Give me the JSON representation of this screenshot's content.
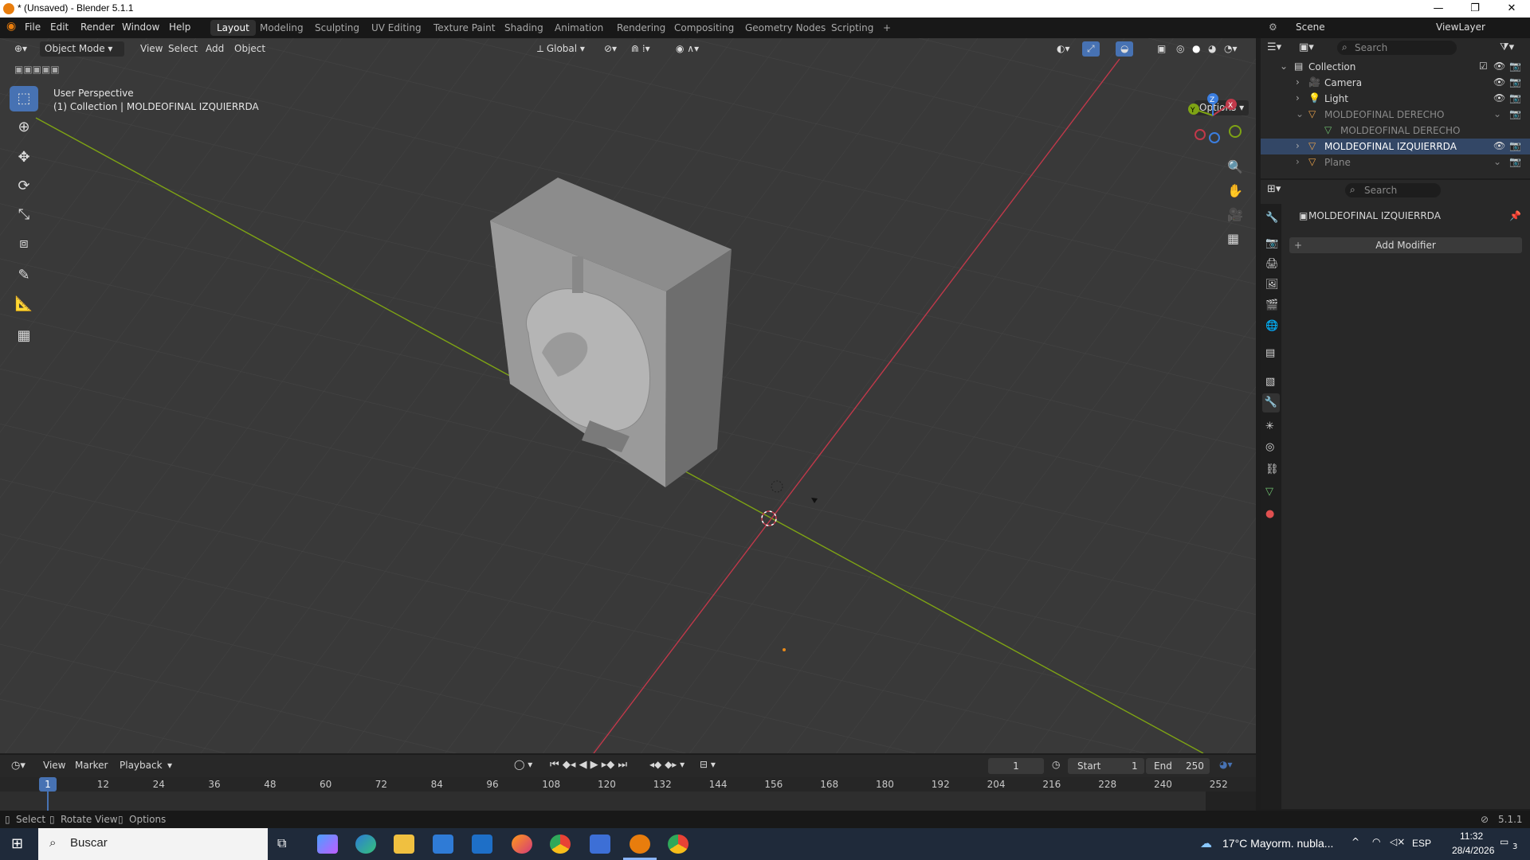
{
  "window": {
    "title": "* (Unsaved) - Blender 5.1.1",
    "min": "—",
    "max": "❐",
    "close": "✕"
  },
  "menu": [
    "File",
    "Edit",
    "Render",
    "Window",
    "Help"
  ],
  "workspaces": [
    "Layout",
    "Modeling",
    "Sculpting",
    "UV Editing",
    "Texture Paint",
    "Shading",
    "Animation",
    "Rendering",
    "Compositing",
    "Geometry Nodes",
    "Scripting"
  ],
  "workspace_add": "+",
  "scene": {
    "name": "Scene",
    "view_layer": "ViewLayer"
  },
  "viewport_header": {
    "mode": "Object Mode",
    "menus": [
      "View",
      "Select",
      "Add",
      "Object"
    ],
    "transform_orientation": "Global",
    "options": "Options"
  },
  "viewport_overlay": {
    "perspective": "User Perspective",
    "collection_info": "(1) Collection | MOLDEOFINAL IZQUIERRDA"
  },
  "gizmo_axes": {
    "x": "X",
    "y": "Y",
    "z": "Z"
  },
  "outliner": {
    "search_placeholder": "Search",
    "collection": "Collection",
    "items": [
      {
        "name": "Camera",
        "visible": true
      },
      {
        "name": "Light",
        "visible": true
      },
      {
        "name": "MOLDEOFINAL DERECHO",
        "visible": false
      },
      {
        "name": "MOLDEOFINAL DERECHO",
        "visible": false
      },
      {
        "name": "MOLDEOFINAL IZQUIERRDA",
        "visible": true
      },
      {
        "name": "Plane",
        "visible": false
      }
    ]
  },
  "properties": {
    "search_placeholder": "Search",
    "object_name": "MOLDEOFINAL IZQUIERRDA",
    "add_modifier": "Add Modifier"
  },
  "timeline": {
    "menus": [
      "View",
      "Marker",
      "Playback"
    ],
    "current_frame": "1",
    "start_label": "Start",
    "start": "1",
    "end_label": "End",
    "end": "250",
    "ticks": [
      "1",
      "12",
      "24",
      "36",
      "48",
      "60",
      "72",
      "84",
      "96",
      "108",
      "120",
      "132",
      "144",
      "156",
      "168",
      "180",
      "192",
      "204",
      "216",
      "228",
      "240",
      "252"
    ]
  },
  "statusbar": {
    "select": "Select",
    "rotate": "Rotate View",
    "options": "Options",
    "version": "5.1.1"
  },
  "taskbar": {
    "search_placeholder": "Buscar",
    "weather": "17°C  Mayorm. nubla...",
    "lang": "ESP",
    "time": "11:32",
    "date": "28/4/2026",
    "notifications": "3"
  },
  "colors": {
    "accent": "#4772b3",
    "x_axis": "#c0394a",
    "y_axis": "#7ea314",
    "z_axis": "#3b7ee0"
  }
}
